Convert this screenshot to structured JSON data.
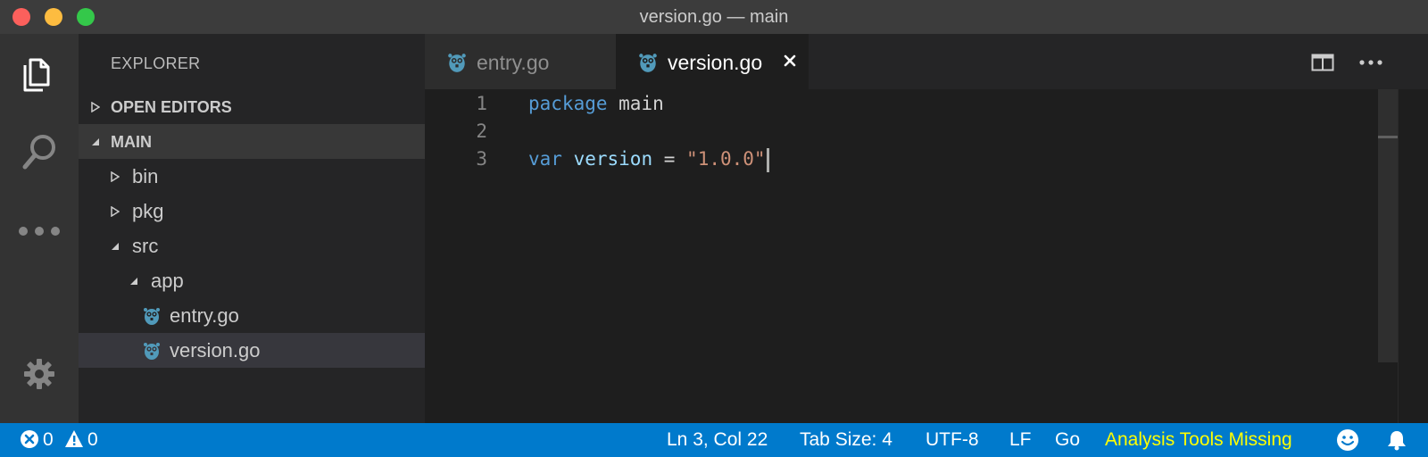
{
  "window": {
    "title": "version.go — main"
  },
  "activity_bar": {
    "items": [
      {
        "name": "explorer",
        "icon": "files-icon",
        "active": true
      },
      {
        "name": "search",
        "icon": "search-icon",
        "active": false
      },
      {
        "name": "more",
        "icon": "ellipsis-icon",
        "active": false
      },
      {
        "name": "manage",
        "icon": "gear-icon",
        "active": false
      }
    ]
  },
  "sidebar": {
    "title": "EXPLORER",
    "sections": [
      {
        "label": "OPEN EDITORS",
        "expanded": false
      },
      {
        "label": "MAIN",
        "expanded": true
      }
    ],
    "tree": [
      {
        "label": "bin",
        "type": "folder",
        "expanded": false,
        "depth": 1
      },
      {
        "label": "pkg",
        "type": "folder",
        "expanded": false,
        "depth": 1
      },
      {
        "label": "src",
        "type": "folder",
        "expanded": true,
        "depth": 1
      },
      {
        "label": "app",
        "type": "folder",
        "expanded": true,
        "depth": 2
      },
      {
        "label": "entry.go",
        "type": "file",
        "icon": "gopher-icon",
        "depth": 3
      },
      {
        "label": "version.go",
        "type": "file",
        "icon": "gopher-icon",
        "depth": 3,
        "selected": true
      }
    ]
  },
  "tabs": [
    {
      "label": "entry.go",
      "icon": "gopher-icon",
      "active": false
    },
    {
      "label": "version.go",
      "icon": "gopher-icon",
      "active": true,
      "close": "✕"
    }
  ],
  "editor": {
    "lines": [
      {
        "number": "1",
        "tokens": [
          {
            "text": "package",
            "kind": "kw"
          },
          {
            "text": " main",
            "kind": "plain"
          }
        ]
      },
      {
        "number": "2",
        "tokens": []
      },
      {
        "number": "3",
        "tokens": [
          {
            "text": "var",
            "kind": "kw"
          },
          {
            "text": " ",
            "kind": "plain"
          },
          {
            "text": "version",
            "kind": "ident"
          },
          {
            "text": " = ",
            "kind": "plain"
          },
          {
            "text": "\"1.0.0\"",
            "kind": "str"
          }
        ]
      }
    ]
  },
  "status_bar": {
    "errors": "0",
    "warnings": "0",
    "cursor_position": "Ln 3, Col 22",
    "tab_size": "Tab Size: 4",
    "encoding": "UTF-8",
    "line_ending": "LF",
    "language": "Go",
    "analysis": "Analysis Tools Missing"
  },
  "colors": {
    "accent": "#007acc",
    "go_icon": "#519aba",
    "warning_text": "#ffff00"
  }
}
